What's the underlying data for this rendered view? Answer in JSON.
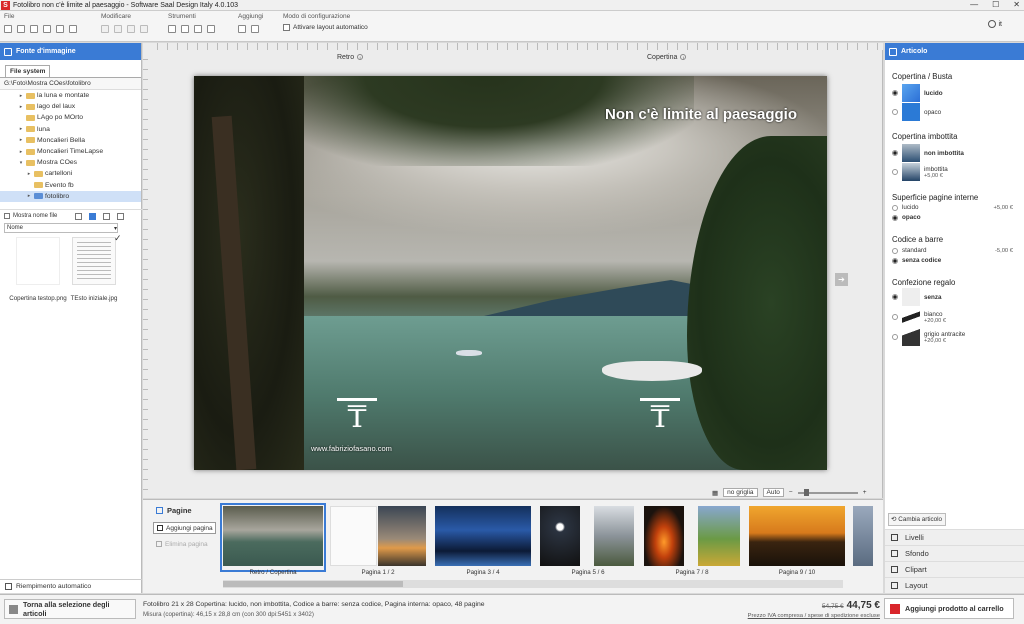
{
  "window": {
    "title": "Fotolibro non c'è limite al paesaggio - Software Saal Design Italy 4.0.103",
    "minimize": "—",
    "maximize": "☐",
    "close": "✕"
  },
  "toolbar": {
    "file_label": "File",
    "modify_label": "Modificare",
    "tools_label": "Strumenti",
    "add_label": "Aggiungi",
    "config_label": "Modo di configurazione",
    "auto_layout": "Attivare layout automatico",
    "language": "it"
  },
  "left": {
    "title": "Fonte d'immagine",
    "tab": "File system",
    "path": "G:\\Foto\\Mostra COes\\fotolibro",
    "tree": [
      {
        "label": "la luna e montate",
        "level": 2,
        "arrow": "▸"
      },
      {
        "label": "lago del laux",
        "level": 2,
        "arrow": "▸"
      },
      {
        "label": "LAgo po MOrto",
        "level": 2,
        "arrow": ""
      },
      {
        "label": "luna",
        "level": 2,
        "arrow": "▸"
      },
      {
        "label": "Moncalieri Bella",
        "level": 2,
        "arrow": "▸"
      },
      {
        "label": "Moncalieri TimeLapse",
        "level": 2,
        "arrow": "▸"
      },
      {
        "label": "Mostra COes",
        "level": 2,
        "arrow": "▾"
      },
      {
        "label": "cartelloni",
        "level": 3,
        "arrow": "▸"
      },
      {
        "label": "Evento fb",
        "level": 3,
        "arrow": ""
      },
      {
        "label": "fotolibro",
        "level": 3,
        "arrow": "▸",
        "selected": true
      }
    ],
    "show_names": "Mostra nome file",
    "sort": "Nome",
    "files": [
      {
        "name": "Copertina testop.png"
      },
      {
        "name": "TEsto iniziale.jpg"
      }
    ],
    "autofill": "Riempimento automatico"
  },
  "canvas": {
    "back_label": "Retro",
    "cover_label": "Copertina",
    "cover_title": "Non c'è limite al paesaggio",
    "watermark_url": "www.fabriziofasano.com",
    "grid": "no griglia",
    "zoom": "Auto",
    "next_arrow": "➔"
  },
  "pages": {
    "title": "Pagine",
    "add": "Aggiungi pagina",
    "delete": "Elimina pagina",
    "thumbs": [
      {
        "label": "Retro / Copertina"
      },
      {
        "label": "Pagina 1 / 2"
      },
      {
        "label": "Pagina 3 / 4"
      },
      {
        "label": "Pagina 5 / 6"
      },
      {
        "label": "Pagina 7 / 8"
      },
      {
        "label": "Pagina 9 / 10"
      }
    ]
  },
  "right": {
    "title": "Articolo",
    "cover_section": "Copertina / Busta",
    "cover_opts": [
      {
        "label": "lucido",
        "selected": true
      },
      {
        "label": "opaco",
        "selected": false
      }
    ],
    "padded_section": "Copertina imbottita",
    "padded_opts": [
      {
        "label": "non imbottita",
        "selected": true
      },
      {
        "label": "imbottita",
        "price": "+5,00 €",
        "selected": false
      }
    ],
    "paper_section": "Superficie pagine interne",
    "paper_opts": [
      {
        "label": "lucido",
        "price": "+5,00 €",
        "selected": false
      },
      {
        "label": "opaco",
        "selected": true
      }
    ],
    "barcode_section": "Codice a barre",
    "barcode_opts": [
      {
        "label": "standard",
        "price": "-5,00 €",
        "selected": false
      },
      {
        "label": "senza codice",
        "selected": true
      }
    ],
    "gift_section": "Confezione regalo",
    "gift_opts": [
      {
        "label": "senza",
        "selected": true
      },
      {
        "label": "bianco",
        "price": "+20,00 €",
        "selected": false
      },
      {
        "label": "grigio antracite",
        "price": "+20,00 €",
        "selected": false
      }
    ],
    "change": "Cambia articolo",
    "nav": [
      {
        "label": "Livelli"
      },
      {
        "label": "Sfondo"
      },
      {
        "label": "Clipart"
      },
      {
        "label": "Layout"
      }
    ]
  },
  "status": {
    "back": "Torna alla selezione degli articoli",
    "product": "Fotolibro 21 x 28 Copertina: lucido, non imbottita, Codice a barre: senza codice, Pagina interna: opaco, 48 pagine",
    "measure": "Misura (copertina): 46,15 x 28,8 cm (con 300 dpi:5451 x 3402)",
    "old_price": "54,75 €",
    "new_price": "44,75 €",
    "iva": "Prezzo IVA compresa / spese di spedizione escluse",
    "add_cart": "Aggiungi prodotto al carrello"
  }
}
